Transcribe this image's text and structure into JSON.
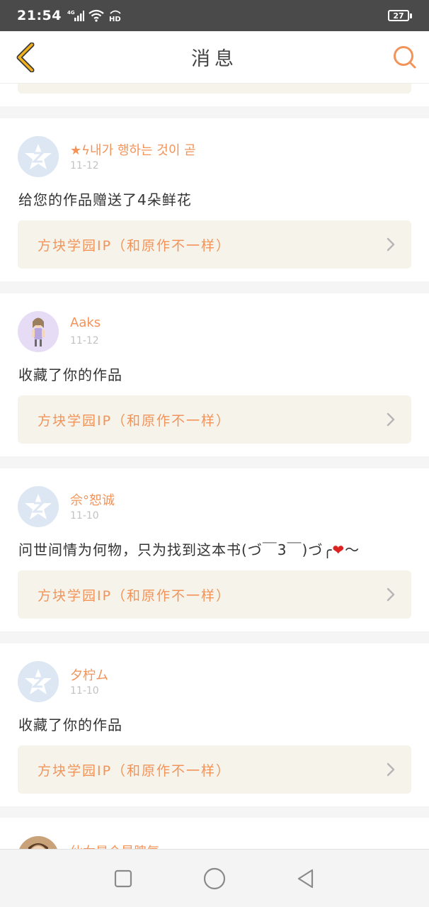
{
  "status_bar": {
    "time": "21:54",
    "network": "4G",
    "hd_label": "HD",
    "battery": "27"
  },
  "header": {
    "title": "消息",
    "back_icon": "chevron-left-icon",
    "search_icon": "search-icon"
  },
  "colors": {
    "accent": "#f2945a",
    "link_bg": "#f5f3ea",
    "icon_gold": "#f0a020"
  },
  "messages": [
    {
      "name": "★ϟ내가 행하는 것이 곧",
      "date": "11-12",
      "text": "给您的作品赠送了4朵鲜花",
      "work": "方块学园IP（和原作不一样）",
      "avatar": "qq-default-avatar"
    },
    {
      "name": "Aaks",
      "date": "11-12",
      "text": "收藏了你的作品",
      "work": "方块学园IP（和原作不一样）",
      "avatar": "anime-avatar"
    },
    {
      "name": "佘°恕诚",
      "date": "11-10",
      "text": "问世间情为何物，只为找到这本书(づ￣3￣)づ╭",
      "text_tail": "～",
      "work": "方块学园IP（和原作不一样）",
      "avatar": "qq-default-avatar"
    },
    {
      "name": "夕柠ム",
      "date": "11-10",
      "text": "收藏了你的作品",
      "work": "方块学园IP（和原作不一样）",
      "avatar": "qq-default-avatar"
    }
  ],
  "partial_message": {
    "name": "仙女是个暴脾气"
  },
  "nav": {
    "recent_icon": "square-icon",
    "home_icon": "circle-icon",
    "back_icon": "triangle-back-icon"
  }
}
